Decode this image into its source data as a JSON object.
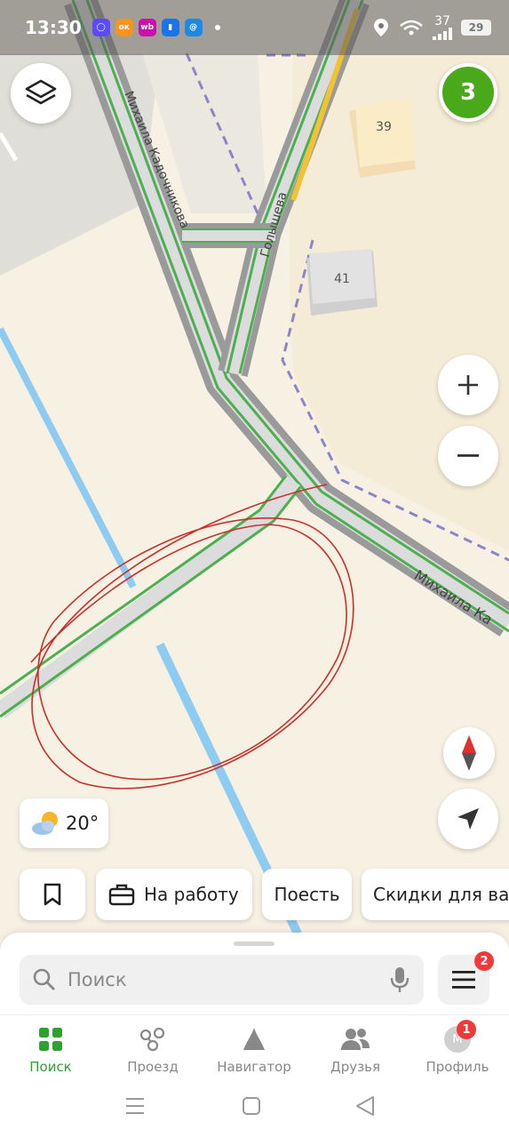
{
  "status_bar": {
    "time": "13:30",
    "signal_value": "37",
    "battery": "29",
    "apps": [
      {
        "name": "messenger-app-icon",
        "glyph": "◯",
        "color": "#5a4bff"
      },
      {
        "name": "ok-app-icon",
        "glyph": "ок",
        "color": "#f7931e"
      },
      {
        "name": "wb-app-icon",
        "glyph": "wb",
        "color": "#cb11ab"
      },
      {
        "name": "ms-app-icon",
        "glyph": "▮",
        "color": "#1a73e8"
      },
      {
        "name": "mail-app-icon",
        "glyph": "@",
        "color": "#1e88e5"
      }
    ]
  },
  "map": {
    "street_1": "Михаила Кадочникова",
    "street_2": "Голышева",
    "street_3": "Михаила Ка",
    "building_1": "39",
    "building_2": "41"
  },
  "level_badge": "3",
  "weather": {
    "temperature": "20°",
    "icon": "sun-behind-cloud-icon"
  },
  "chips": {
    "work": "На работу",
    "eat": "Поесть",
    "deals": "Скидки для ва"
  },
  "search": {
    "placeholder": "Поиск"
  },
  "menu_badge": "2",
  "tabs": [
    {
      "label": "Поиск",
      "icon": "grid-icon",
      "active": true
    },
    {
      "label": "Проезд",
      "icon": "transit-icon",
      "active": false
    },
    {
      "label": "Навигатор",
      "icon": "navigator-icon",
      "active": false
    },
    {
      "label": "Друзья",
      "icon": "friends-icon",
      "active": false
    },
    {
      "label": "Профиль",
      "icon": "avatar-icon",
      "active": false
    }
  ],
  "profile": {
    "initial": "М",
    "badge": "1"
  },
  "colors": {
    "accent": "#2fa12f",
    "badge_green": "#4aa81b",
    "badge_red": "#f03a3a",
    "road": "#9a9a9a",
    "water": "#8ecbf0",
    "annotation": "#c8302c"
  }
}
